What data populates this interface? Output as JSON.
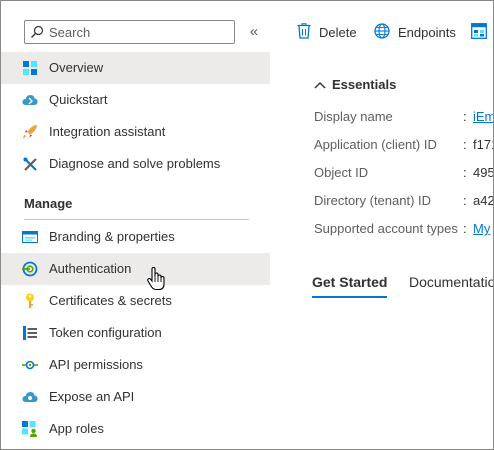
{
  "search": {
    "placeholder": "Search"
  },
  "sidebar": {
    "collapse_glyph": "«",
    "items_top": [
      {
        "label": "Overview",
        "icon": "overview-grid-icon",
        "selected": true
      },
      {
        "label": "Quickstart",
        "icon": "cloud-quickstart-icon"
      },
      {
        "label": "Integration assistant",
        "icon": "rocket-icon"
      },
      {
        "label": "Diagnose and solve problems",
        "icon": "wrench-icon"
      }
    ],
    "section_title": "Manage",
    "items_manage": [
      {
        "label": "Branding & properties",
        "icon": "branding-card-icon"
      },
      {
        "label": "Authentication",
        "icon": "authentication-icon",
        "hover": true
      },
      {
        "label": "Certificates & secrets",
        "icon": "key-icon"
      },
      {
        "label": "Token configuration",
        "icon": "token-bars-icon"
      },
      {
        "label": "API permissions",
        "icon": "api-permissions-icon"
      },
      {
        "label": "Expose an API",
        "icon": "cloud-api-icon"
      },
      {
        "label": "App roles",
        "icon": "app-roles-icon"
      }
    ]
  },
  "toolbar": {
    "delete_label": "Delete",
    "endpoints_label": "Endpoints"
  },
  "essentials": {
    "title": "Essentials",
    "rows": [
      {
        "label": "Display name",
        "value": "iEm",
        "link": true
      },
      {
        "label": "Application (client) ID",
        "value": "f171"
      },
      {
        "label": "Object ID",
        "value": "495"
      },
      {
        "label": "Directory (tenant) ID",
        "value": "a42"
      },
      {
        "label": "Supported account types",
        "value": "My",
        "link": true
      }
    ]
  },
  "tabs": [
    {
      "label": "Get Started",
      "active": true
    },
    {
      "label": "Documentation"
    }
  ],
  "colors": {
    "accent": "#0078d4",
    "selected_bg": "#edebe9",
    "text": "#323130"
  }
}
